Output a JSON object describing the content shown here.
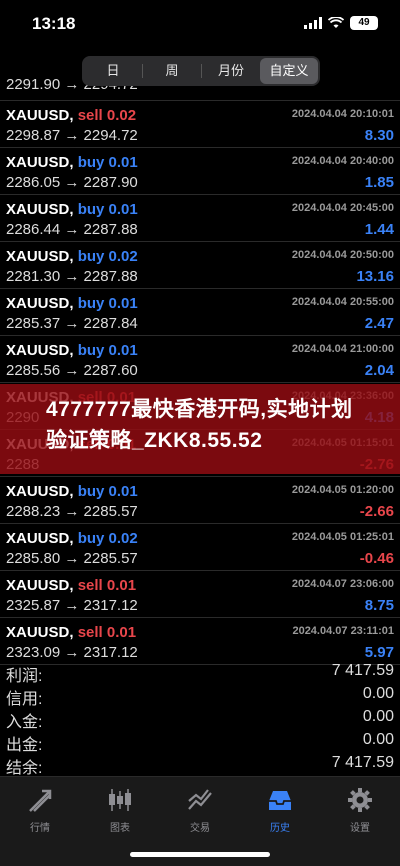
{
  "status": {
    "time": "13:18",
    "battery": "49"
  },
  "tabs": [
    "日",
    "周",
    "月份",
    "自定义"
  ],
  "trades": [
    {
      "symbol": "XAUUSD",
      "side": "sell",
      "side_label": "sell 0.02",
      "prices": "2298.87 → 2294.72",
      "date": "2024.04.04 20:10:01",
      "pl": "8.30",
      "pl_sign": "pos"
    },
    {
      "symbol": "XAUUSD",
      "side": "buy",
      "side_label": "buy 0.01",
      "prices": "2286.05 → 2287.90",
      "date": "2024.04.04 20:40:00",
      "pl": "1.85",
      "pl_sign": "pos"
    },
    {
      "symbol": "XAUUSD",
      "side": "buy",
      "side_label": "buy 0.01",
      "prices": "2286.44 → 2287.88",
      "date": "2024.04.04 20:45:00",
      "pl": "1.44",
      "pl_sign": "pos"
    },
    {
      "symbol": "XAUUSD",
      "side": "buy",
      "side_label": "buy 0.02",
      "prices": "2281.30 → 2287.88",
      "date": "2024.04.04 20:50:00",
      "pl": "13.16",
      "pl_sign": "pos"
    },
    {
      "symbol": "XAUUSD",
      "side": "buy",
      "side_label": "buy 0.01",
      "prices": "2285.37 → 2287.84",
      "date": "2024.04.04 20:55:00",
      "pl": "2.47",
      "pl_sign": "pos"
    },
    {
      "symbol": "XAUUSD",
      "side": "buy",
      "side_label": "buy 0.01",
      "prices": "2285.56 → 2287.60",
      "date": "2024.04.04 21:00:00",
      "pl": "2.04",
      "pl_sign": "pos"
    },
    {
      "symbol": "XAUUSD",
      "side": "sell",
      "side_label": "sell 0.01",
      "prices": "2290",
      "date": "2024.04.04 23:36:00",
      "pl": "4.18",
      "pl_sign": "pos"
    },
    {
      "symbol": "XAUUSD",
      "side": "sell",
      "side_label": "sell 0.01",
      "prices": "2288",
      "date": "2024.04.05 01:15:01",
      "pl": "-2.76",
      "pl_sign": "neg"
    },
    {
      "symbol": "XAUUSD",
      "side": "buy",
      "side_label": "buy 0.01",
      "prices": "2288.23 → 2285.57",
      "date": "2024.04.05 01:20:00",
      "pl": "-2.66",
      "pl_sign": "neg"
    },
    {
      "symbol": "XAUUSD",
      "side": "buy",
      "side_label": "buy 0.02",
      "prices": "2285.80 → 2285.57",
      "date": "2024.04.05 01:25:01",
      "pl": "-0.46",
      "pl_sign": "neg"
    },
    {
      "symbol": "XAUUSD",
      "side": "sell",
      "side_label": "sell 0.01",
      "prices": "2325.87 → 2317.12",
      "date": "2024.04.07 23:06:00",
      "pl": "8.75",
      "pl_sign": "pos"
    },
    {
      "symbol": "XAUUSD",
      "side": "sell",
      "side_label": "sell 0.01",
      "prices": "2323.09 → 2317.12",
      "date": "2024.04.07 23:11:01",
      "pl": "5.97",
      "pl_sign": "pos"
    }
  ],
  "partial_row": {
    "prices": "2291.90 → 2294.72"
  },
  "banner": {
    "text": "4777777最快香港开码,实地计划验证策略_ZKK8.55.52"
  },
  "summary": [
    {
      "label": "利润:",
      "value": "7 417.59"
    },
    {
      "label": "信用:",
      "value": "0.00"
    },
    {
      "label": "入金:",
      "value": "0.00"
    },
    {
      "label": "出金:",
      "value": "0.00"
    },
    {
      "label": "结余:",
      "value": "7 417.59"
    }
  ],
  "bottom_tabs": [
    {
      "label": "行情",
      "icon": "quotes-icon"
    },
    {
      "label": "图表",
      "icon": "chart-icon"
    },
    {
      "label": "交易",
      "icon": "trade-icon"
    },
    {
      "label": "历史",
      "icon": "history-icon"
    },
    {
      "label": "设置",
      "icon": "settings-icon"
    }
  ],
  "colors": {
    "accent": "#3a82f7",
    "sell": "#e8464b",
    "banner": "#96121"
  }
}
